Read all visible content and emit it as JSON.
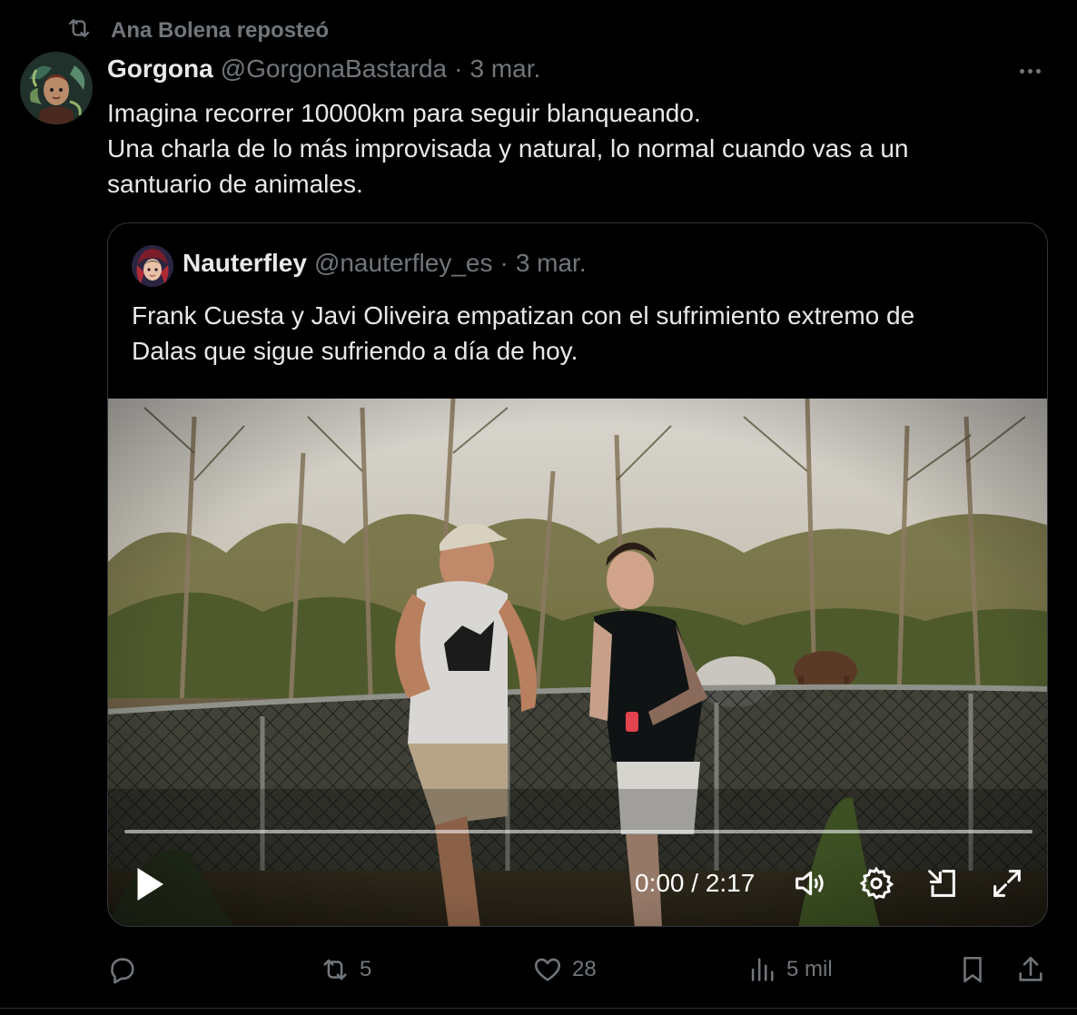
{
  "repost": {
    "label": "Ana Bolena reposteó"
  },
  "post": {
    "author_name": "Gorgona",
    "author_handle": "@GorgonaBastarda",
    "separator": "·",
    "date": "3 mar.",
    "text_lines": [
      "Imagina recorrer 10000km para seguir blanqueando.",
      "Una charla de lo más improvisada y natural, lo normal cuando vas a un",
      "santuario de animales."
    ]
  },
  "quote": {
    "author_name": "Nauterfley",
    "author_handle": "@nauterfley_es",
    "separator": "·",
    "date": "3 mar.",
    "text_lines": [
      "Frank Cuesta y Javi Oliveira empatizan con el sufrimiento extremo de",
      "Dalas que sigue sufriendo a día de hoy."
    ],
    "video": {
      "time_display": "0:00 / 2:17",
      "progress_fraction": 0.0,
      "icons": [
        "play-icon",
        "volume-icon",
        "settings-icon",
        "minimize-icon",
        "fullscreen-icon"
      ]
    }
  },
  "actions": {
    "reply_count": "",
    "repost_count": "5",
    "like_count": "28",
    "views_count": "5 mil"
  },
  "colors": {
    "background": "#000000",
    "text_primary": "#e7e9ea",
    "text_secondary": "#71767b",
    "border": "#333639"
  }
}
